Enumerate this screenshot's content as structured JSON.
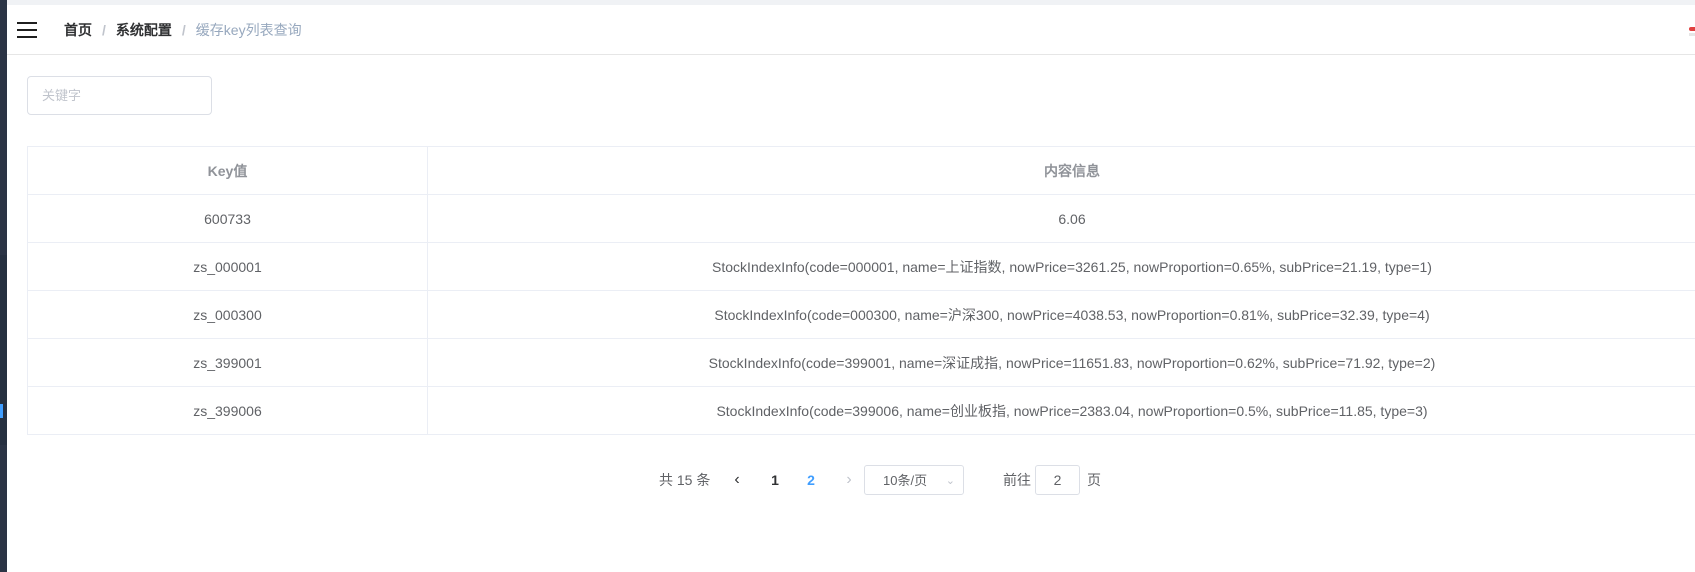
{
  "navbar": {
    "breadcrumb": [
      "首页",
      "系统配置",
      "缓存key列表查询"
    ],
    "separator": "/"
  },
  "search": {
    "placeholder": "关键字",
    "value": ""
  },
  "table": {
    "headers": [
      "Key值",
      "内容信息"
    ],
    "rows": [
      [
        "600733",
        "6.06"
      ],
      [
        "zs_000001",
        "StockIndexInfo(code=000001, name=上证指数, nowPrice=3261.25, nowProportion=0.65%, subPrice=21.19, type=1)"
      ],
      [
        "zs_000300",
        "StockIndexInfo(code=000300, name=沪深300, nowPrice=4038.53, nowProportion=0.81%, subPrice=32.39, type=4)"
      ],
      [
        "zs_399001",
        "StockIndexInfo(code=399001, name=深证成指, nowPrice=11651.83, nowProportion=0.62%, subPrice=71.92, type=2)"
      ],
      [
        "zs_399006",
        "StockIndexInfo(code=399006, name=创业板指, nowPrice=2383.04, nowProportion=0.5%, subPrice=11.85, type=3)"
      ]
    ]
  },
  "pagination": {
    "total": "共 15 条",
    "pages": [
      "1",
      "2"
    ],
    "current_page": "2",
    "page_size": "10条/页",
    "goto_prefix": "前往",
    "goto_value": "2",
    "goto_suffix": "页"
  },
  "icons": {
    "menu": "hamburger-icon",
    "prev": "chevron-left-icon",
    "next": "chevron-right-icon",
    "dropdown": "chevron-down-icon"
  },
  "colors": {
    "accent": "#409eff",
    "sidebar": "#2b3445",
    "border": "#ebeef5"
  }
}
